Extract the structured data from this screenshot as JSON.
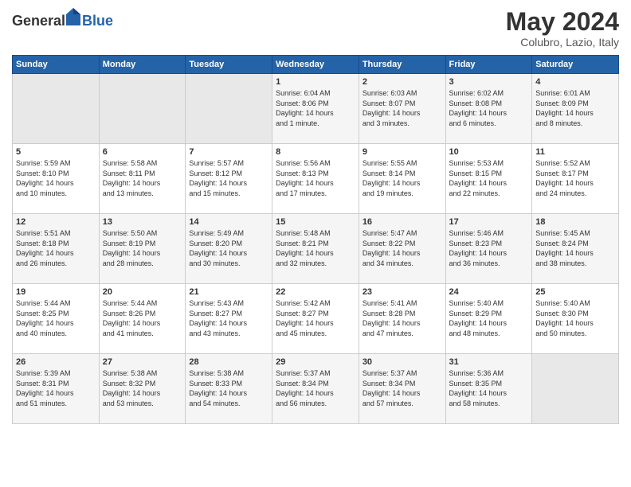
{
  "logo": {
    "general": "General",
    "blue": "Blue"
  },
  "title": "May 2024",
  "subtitle": "Colubro, Lazio, Italy",
  "days_header": [
    "Sunday",
    "Monday",
    "Tuesday",
    "Wednesday",
    "Thursday",
    "Friday",
    "Saturday"
  ],
  "weeks": [
    [
      {
        "num": "",
        "lines": []
      },
      {
        "num": "",
        "lines": []
      },
      {
        "num": "",
        "lines": []
      },
      {
        "num": "1",
        "lines": [
          "Sunrise: 6:04 AM",
          "Sunset: 8:06 PM",
          "Daylight: 14 hours",
          "and 1 minute."
        ]
      },
      {
        "num": "2",
        "lines": [
          "Sunrise: 6:03 AM",
          "Sunset: 8:07 PM",
          "Daylight: 14 hours",
          "and 3 minutes."
        ]
      },
      {
        "num": "3",
        "lines": [
          "Sunrise: 6:02 AM",
          "Sunset: 8:08 PM",
          "Daylight: 14 hours",
          "and 6 minutes."
        ]
      },
      {
        "num": "4",
        "lines": [
          "Sunrise: 6:01 AM",
          "Sunset: 8:09 PM",
          "Daylight: 14 hours",
          "and 8 minutes."
        ]
      }
    ],
    [
      {
        "num": "5",
        "lines": [
          "Sunrise: 5:59 AM",
          "Sunset: 8:10 PM",
          "Daylight: 14 hours",
          "and 10 minutes."
        ]
      },
      {
        "num": "6",
        "lines": [
          "Sunrise: 5:58 AM",
          "Sunset: 8:11 PM",
          "Daylight: 14 hours",
          "and 13 minutes."
        ]
      },
      {
        "num": "7",
        "lines": [
          "Sunrise: 5:57 AM",
          "Sunset: 8:12 PM",
          "Daylight: 14 hours",
          "and 15 minutes."
        ]
      },
      {
        "num": "8",
        "lines": [
          "Sunrise: 5:56 AM",
          "Sunset: 8:13 PM",
          "Daylight: 14 hours",
          "and 17 minutes."
        ]
      },
      {
        "num": "9",
        "lines": [
          "Sunrise: 5:55 AM",
          "Sunset: 8:14 PM",
          "Daylight: 14 hours",
          "and 19 minutes."
        ]
      },
      {
        "num": "10",
        "lines": [
          "Sunrise: 5:53 AM",
          "Sunset: 8:15 PM",
          "Daylight: 14 hours",
          "and 22 minutes."
        ]
      },
      {
        "num": "11",
        "lines": [
          "Sunrise: 5:52 AM",
          "Sunset: 8:17 PM",
          "Daylight: 14 hours",
          "and 24 minutes."
        ]
      }
    ],
    [
      {
        "num": "12",
        "lines": [
          "Sunrise: 5:51 AM",
          "Sunset: 8:18 PM",
          "Daylight: 14 hours",
          "and 26 minutes."
        ]
      },
      {
        "num": "13",
        "lines": [
          "Sunrise: 5:50 AM",
          "Sunset: 8:19 PM",
          "Daylight: 14 hours",
          "and 28 minutes."
        ]
      },
      {
        "num": "14",
        "lines": [
          "Sunrise: 5:49 AM",
          "Sunset: 8:20 PM",
          "Daylight: 14 hours",
          "and 30 minutes."
        ]
      },
      {
        "num": "15",
        "lines": [
          "Sunrise: 5:48 AM",
          "Sunset: 8:21 PM",
          "Daylight: 14 hours",
          "and 32 minutes."
        ]
      },
      {
        "num": "16",
        "lines": [
          "Sunrise: 5:47 AM",
          "Sunset: 8:22 PM",
          "Daylight: 14 hours",
          "and 34 minutes."
        ]
      },
      {
        "num": "17",
        "lines": [
          "Sunrise: 5:46 AM",
          "Sunset: 8:23 PM",
          "Daylight: 14 hours",
          "and 36 minutes."
        ]
      },
      {
        "num": "18",
        "lines": [
          "Sunrise: 5:45 AM",
          "Sunset: 8:24 PM",
          "Daylight: 14 hours",
          "and 38 minutes."
        ]
      }
    ],
    [
      {
        "num": "19",
        "lines": [
          "Sunrise: 5:44 AM",
          "Sunset: 8:25 PM",
          "Daylight: 14 hours",
          "and 40 minutes."
        ]
      },
      {
        "num": "20",
        "lines": [
          "Sunrise: 5:44 AM",
          "Sunset: 8:26 PM",
          "Daylight: 14 hours",
          "and 41 minutes."
        ]
      },
      {
        "num": "21",
        "lines": [
          "Sunrise: 5:43 AM",
          "Sunset: 8:27 PM",
          "Daylight: 14 hours",
          "and 43 minutes."
        ]
      },
      {
        "num": "22",
        "lines": [
          "Sunrise: 5:42 AM",
          "Sunset: 8:27 PM",
          "Daylight: 14 hours",
          "and 45 minutes."
        ]
      },
      {
        "num": "23",
        "lines": [
          "Sunrise: 5:41 AM",
          "Sunset: 8:28 PM",
          "Daylight: 14 hours",
          "and 47 minutes."
        ]
      },
      {
        "num": "24",
        "lines": [
          "Sunrise: 5:40 AM",
          "Sunset: 8:29 PM",
          "Daylight: 14 hours",
          "and 48 minutes."
        ]
      },
      {
        "num": "25",
        "lines": [
          "Sunrise: 5:40 AM",
          "Sunset: 8:30 PM",
          "Daylight: 14 hours",
          "and 50 minutes."
        ]
      }
    ],
    [
      {
        "num": "26",
        "lines": [
          "Sunrise: 5:39 AM",
          "Sunset: 8:31 PM",
          "Daylight: 14 hours",
          "and 51 minutes."
        ]
      },
      {
        "num": "27",
        "lines": [
          "Sunrise: 5:38 AM",
          "Sunset: 8:32 PM",
          "Daylight: 14 hours",
          "and 53 minutes."
        ]
      },
      {
        "num": "28",
        "lines": [
          "Sunrise: 5:38 AM",
          "Sunset: 8:33 PM",
          "Daylight: 14 hours",
          "and 54 minutes."
        ]
      },
      {
        "num": "29",
        "lines": [
          "Sunrise: 5:37 AM",
          "Sunset: 8:34 PM",
          "Daylight: 14 hours",
          "and 56 minutes."
        ]
      },
      {
        "num": "30",
        "lines": [
          "Sunrise: 5:37 AM",
          "Sunset: 8:34 PM",
          "Daylight: 14 hours",
          "and 57 minutes."
        ]
      },
      {
        "num": "31",
        "lines": [
          "Sunrise: 5:36 AM",
          "Sunset: 8:35 PM",
          "Daylight: 14 hours",
          "and 58 minutes."
        ]
      },
      {
        "num": "",
        "lines": []
      }
    ]
  ]
}
